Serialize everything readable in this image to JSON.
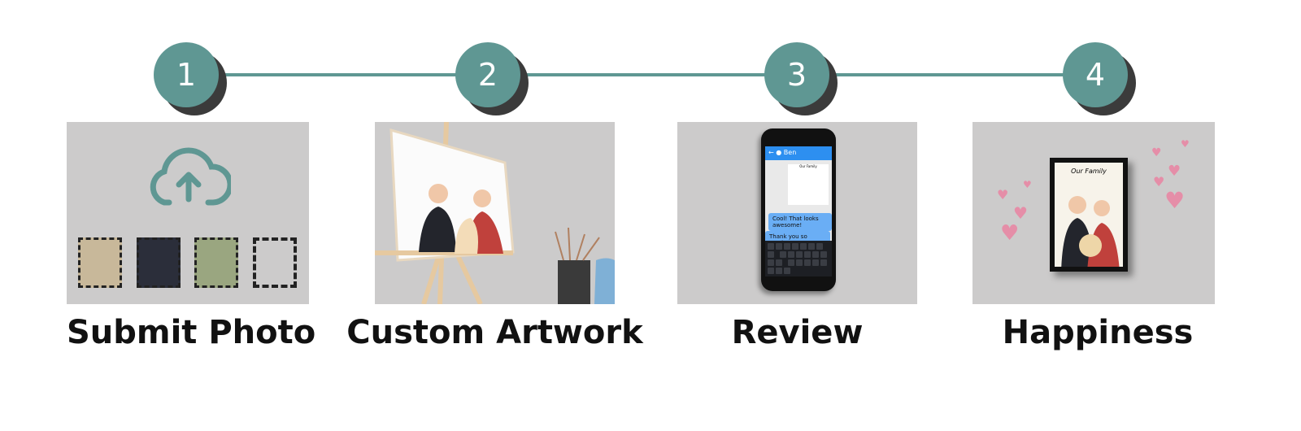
{
  "colors": {
    "accent": "#5f9793",
    "shadow": "#3b3b3b",
    "panel": "#cccbcb"
  },
  "steps": [
    {
      "number": "1",
      "title": "Submit Photo",
      "icon": "cloud-upload-icon"
    },
    {
      "number": "2",
      "title": "Custom Artwork",
      "icon": "easel-canvas-icon"
    },
    {
      "number": "3",
      "title": "Review",
      "icon": "phone-chat-icon"
    },
    {
      "number": "4",
      "title": "Happiness",
      "icon": "framed-portrait-icon"
    }
  ],
  "chat": {
    "contact": "Ben",
    "artwork_caption": "Our Family",
    "messages": [
      "Cool! That looks awesome!",
      "Thank you so much! ❤"
    ]
  },
  "frame": {
    "caption": "Our Family"
  }
}
